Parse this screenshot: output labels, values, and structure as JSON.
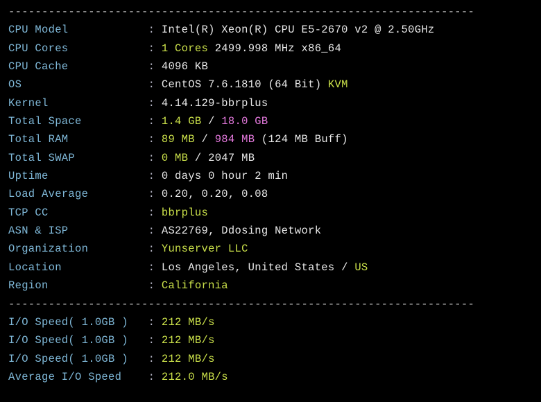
{
  "sep": "----------------------------------------------------------------------",
  "colon": ":",
  "slash": "/",
  "rows": {
    "cpu_model": {
      "label": "CPU Model           ",
      "v1": "Intel(R) Xeon(R) CPU E5-2670 v2 @ 2.50GHz"
    },
    "cpu_cores": {
      "label": "CPU Cores           ",
      "v1": "1 Cores",
      "v2": "2499.998 MHz x86_64"
    },
    "cpu_cache": {
      "label": "CPU Cache           ",
      "v1": "4096 KB"
    },
    "os": {
      "label": "OS                  ",
      "v1": "CentOS 7.6.1810 (64 Bit)",
      "v2": "KVM"
    },
    "kernel": {
      "label": "Kernel              ",
      "v1": "4.14.129-bbrplus"
    },
    "total_space": {
      "label": "Total Space         ",
      "v1": "1.4 GB",
      "v2": "18.0 GB"
    },
    "total_ram": {
      "label": "Total RAM           ",
      "v1": "89 MB",
      "v2": "984 MB",
      "v3": "(124 MB Buff)"
    },
    "total_swap": {
      "label": "Total SWAP          ",
      "v1": "0 MB",
      "v2": "2047 MB"
    },
    "uptime": {
      "label": "Uptime              ",
      "v1": "0 days 0 hour 2 min"
    },
    "load_avg": {
      "label": "Load Average        ",
      "v1": "0.20, 0.20, 0.08"
    },
    "tcp_cc": {
      "label": "TCP CC              ",
      "v1": "bbrplus"
    },
    "asn_isp": {
      "label": "ASN & ISP           ",
      "v1": "AS22769, Ddosing Network"
    },
    "org": {
      "label": "Organization        ",
      "v1": "Yunserver LLC"
    },
    "location": {
      "label": "Location            ",
      "v1": "Los Angeles, United States",
      "v2": "US"
    },
    "region": {
      "label": "Region              ",
      "v1": "California"
    },
    "io1": {
      "label": "I/O Speed( 1.0GB )  ",
      "v1": "212 MB/s"
    },
    "io2": {
      "label": "I/O Speed( 1.0GB )  ",
      "v1": "212 MB/s"
    },
    "io3": {
      "label": "I/O Speed( 1.0GB )  ",
      "v1": "212 MB/s"
    },
    "io_avg": {
      "label": "Average I/O Speed   ",
      "v1": "212.0 MB/s"
    }
  }
}
